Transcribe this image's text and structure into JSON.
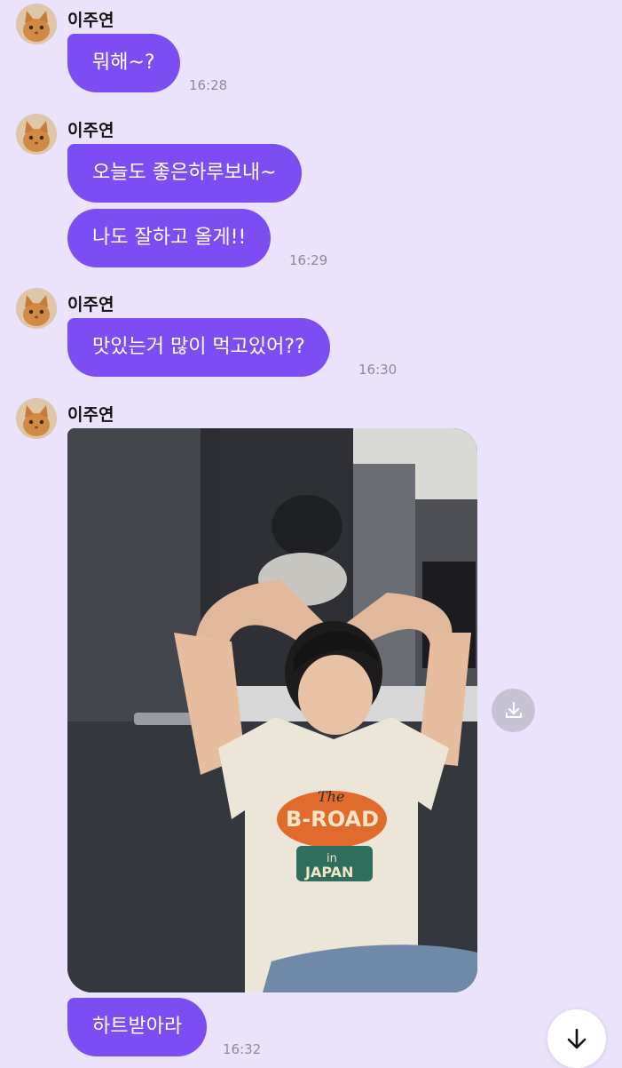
{
  "messages": [
    {
      "sender": "이주연",
      "bubbles": [
        "뭐해~?"
      ],
      "time": "16:28"
    },
    {
      "sender": "이주연",
      "bubbles": [
        "오늘도 좋은하루보내~",
        "나도 잘하고 올게!!"
      ],
      "time": "16:29"
    },
    {
      "sender": "이주연",
      "bubbles": [
        "맛있는거 많이 먹고있어??"
      ],
      "time": "16:30"
    },
    {
      "sender": "이주연",
      "photo": {
        "shirt_text": [
          "The",
          "B-ROAD",
          "in",
          "JAPAN"
        ]
      },
      "bubbles": [
        "하트받아라"
      ],
      "time": "16:32"
    }
  ],
  "icons": {
    "download": "download-icon",
    "scroll_down": "arrow-down-icon",
    "avatar": "cat-avatar-icon"
  },
  "colors": {
    "background": "#ebe3fb",
    "bubble": "#7c4df2",
    "bubble_text": "#ffffff",
    "time": "#8e8a99"
  }
}
